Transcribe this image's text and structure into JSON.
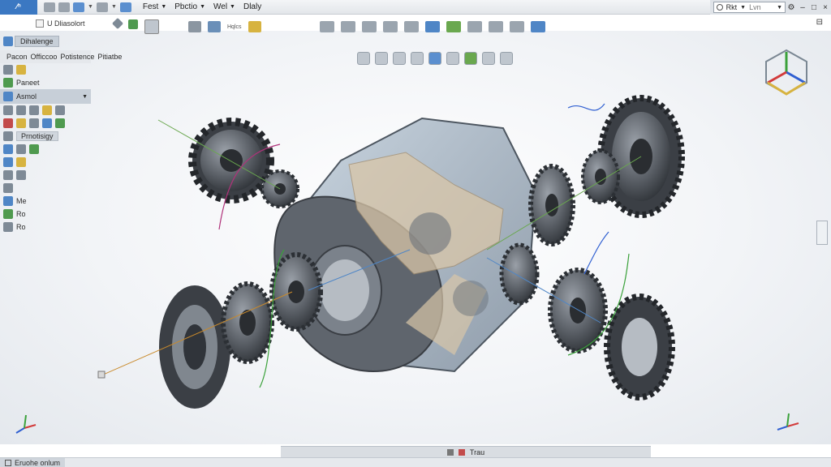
{
  "titlebar": {
    "logo_label": "⁄ⁿ",
    "menus": [
      "Fest",
      "Pbctio",
      "Wel",
      "Dlaly"
    ],
    "search_label": "Rkt",
    "search_placeholder": "Lvn",
    "window_controls": [
      "–",
      "□",
      "×"
    ]
  },
  "document": {
    "title": "U Dliasolort",
    "corner_label": "⊟"
  },
  "left_toolbar": {
    "label": "Hqlcs"
  },
  "feature_manager": {
    "tab_title": "Dihalenge",
    "tabs": [
      "Pacon",
      "Officcoo",
      "Potistence",
      "Pitiatbe"
    ],
    "rows": [
      "Paneet",
      "Asmol",
      "Prnotisigy",
      "Me",
      "Ro",
      "Ro"
    ]
  },
  "bottom": {
    "tab_label": "Trau",
    "status_text": "Eruohe onlum"
  },
  "colors": {
    "accent": "#3b78c2",
    "background": "#f2f4f7",
    "part_gray": "#5a5f66",
    "housing_glass": "#9fb0c2",
    "cut_face": "#d9c6a8",
    "axis_x": "#d23a3a",
    "axis_y": "#3aa13a",
    "axis_z": "#2f5fd1"
  },
  "icons": [
    "search-icon",
    "gear-icon",
    "view-cube-icon",
    "triad-icon"
  ]
}
